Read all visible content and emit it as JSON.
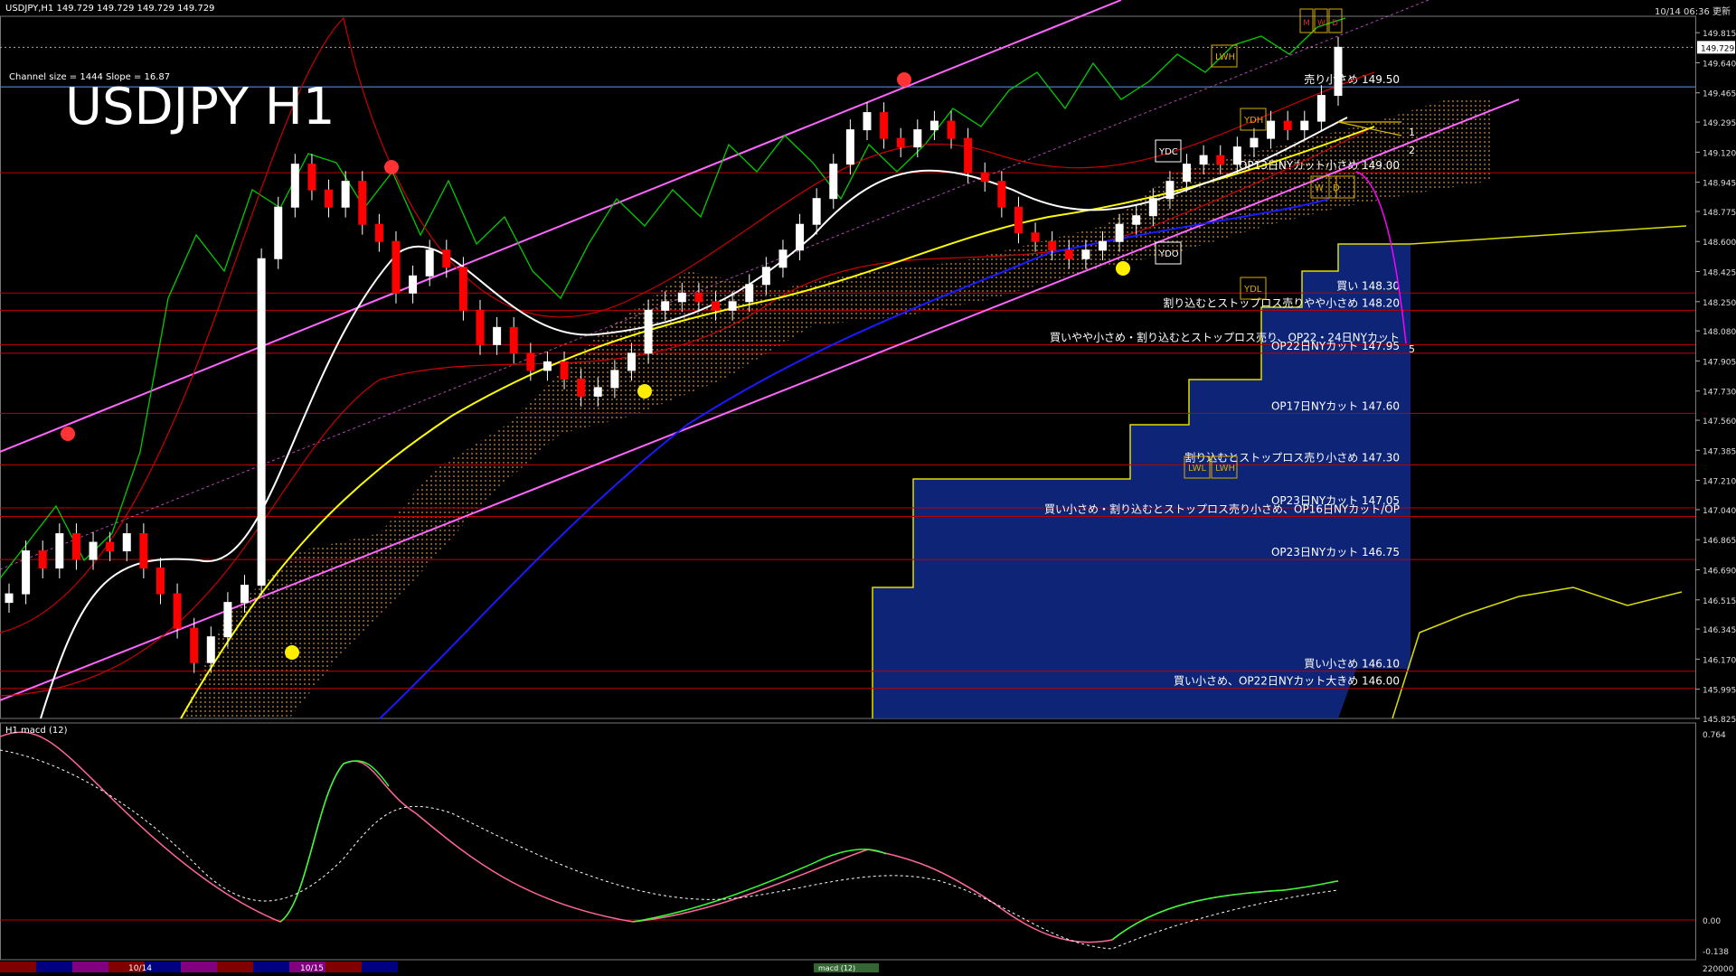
{
  "header": {
    "symbol_line": "USDJPY,H1  149.729 149.729 149.729 149.729",
    "timestamp": "10/14 06:36 更新",
    "channel_info": "Channel size = 1444 Slope = 16.87"
  },
  "sub_window": {
    "label": "H1  macd (12)",
    "scale": [
      "0.764",
      "0.00",
      "-0.138"
    ],
    "bottom_value": "220000"
  },
  "bottom_bar": {
    "dates": [
      "10/14",
      "10/15"
    ],
    "tag": "macd (12)"
  },
  "corner_boxes": [
    "M",
    "W",
    "D"
  ],
  "colors": {
    "background": "#000000",
    "price_line": "#ffffff",
    "ma_fast": "#ffffff",
    "ma_mid": "#ffff00",
    "ma_slow": "#1a1aff",
    "channel": "#ff66ff",
    "level_line": "#c00000",
    "chikou": "#00cc00",
    "macd_rising": "#33ff33",
    "macd_falling": "#ff6699",
    "kumo_blue": "#102a8c",
    "kumo_orange": "#ffaa44"
  },
  "chart_data": {
    "type": "candlestick",
    "title": "USDJPY H1",
    "ylim": [
      145.825,
      149.9
    ],
    "y_ticks": [
      "149.815",
      "149.640",
      "149.465",
      "149.295",
      "149.120",
      "148.945",
      "148.775",
      "148.600",
      "148.425",
      "148.250",
      "148.080",
      "147.905",
      "147.730",
      "147.560",
      "147.385",
      "147.210",
      "147.040",
      "146.865",
      "146.690",
      "146.515",
      "146.345",
      "146.170",
      "145.995",
      "145.825"
    ],
    "current_price_label": "149.729",
    "level_annotations": [
      {
        "price": 149.5,
        "text": "売り小さめ 149.50"
      },
      {
        "price": 149.0,
        "text": "OP13日NYカット小さめ 149.00"
      },
      {
        "price": 148.3,
        "text": "買い 148.30"
      },
      {
        "price": 148.2,
        "text": "割り込むとストップロス売りやや小さめ 148.20"
      },
      {
        "price": 148.0,
        "text": "買いやや小さめ・割り込むとストップロス売り、OP22・24日NYカット"
      },
      {
        "price": 147.95,
        "text": "OP22日NYカット 147.95"
      },
      {
        "price": 147.6,
        "text": "OP17日NYカット 147.60"
      },
      {
        "price": 147.3,
        "text": "割り込むとストップロス売り小さめ 147.30"
      },
      {
        "price": 147.05,
        "text": "OP23日NYカット 147.05"
      },
      {
        "price": 147.0,
        "text": "買い小さめ・割り込むとストップロス売り小さめ、OP16日NYカット/OP"
      },
      {
        "price": 146.75,
        "text": "OP23日NYカット 146.75"
      },
      {
        "price": 146.1,
        "text": "買い小さめ 146.10"
      },
      {
        "price": 146.0,
        "text": "買い小さめ、OP22日NYカット大きめ 146.00"
      }
    ],
    "projection_labels": [
      "1",
      "2",
      "5"
    ],
    "marker_boxes": [
      "LWH",
      "YDH",
      "YDC",
      "YDO",
      "YDL",
      "LWL",
      "LWH",
      "W",
      "D"
    ],
    "series": [
      {
        "name": "price",
        "values": [
          146.55,
          146.8,
          146.7,
          146.9,
          146.75,
          146.85,
          146.8,
          146.9,
          146.7,
          146.55,
          146.35,
          146.15,
          146.3,
          146.5,
          146.6,
          148.5,
          148.8,
          149.05,
          148.9,
          148.8,
          148.95,
          148.7,
          148.6,
          148.3,
          148.4,
          148.55,
          148.45,
          148.2,
          148.0,
          148.1,
          147.95,
          147.85,
          147.9,
          147.8,
          147.7,
          147.75,
          147.85,
          147.95,
          148.2,
          148.25,
          148.3,
          148.25,
          148.2,
          148.25,
          148.35,
          148.45,
          148.55,
          148.7,
          148.85,
          149.05,
          149.25,
          149.35,
          149.2,
          149.15,
          149.25,
          149.3,
          149.2,
          149.0,
          148.95,
          148.8,
          148.65,
          148.6,
          148.55,
          148.5,
          148.55,
          148.6,
          148.7,
          148.75,
          148.85,
          148.95,
          149.05,
          149.1,
          149.05,
          149.15,
          149.2,
          149.3,
          149.25,
          149.3,
          149.45,
          149.73
        ]
      }
    ]
  }
}
